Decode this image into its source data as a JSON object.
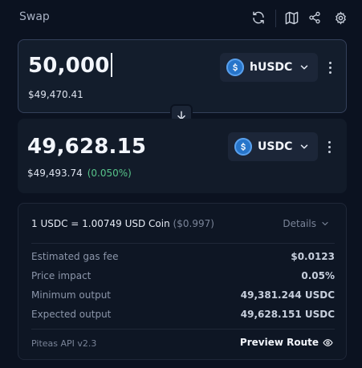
{
  "header": {
    "title": "Swap",
    "icons": [
      "refresh-icon",
      "map-icon",
      "share-icon",
      "settings-gear-icon"
    ]
  },
  "from": {
    "amount": "50,000",
    "usd_value": "$49,470.41",
    "token": "hUSDC",
    "token_icon": "usdc-coin-icon"
  },
  "to": {
    "amount": "49,628.15",
    "usd_value": "$49,493.74",
    "price_impact": "(0.050%)",
    "token": "USDC",
    "token_icon": "usdc-coin-icon"
  },
  "details": {
    "rate_main": "1 USDC = 1.00749 USD Coin",
    "rate_usd": "($0.997)",
    "toggle_label": "Details",
    "rows": [
      {
        "label": "Estimated gas fee",
        "value": "$0.0123"
      },
      {
        "label": "Price impact",
        "value": "0.05%"
      },
      {
        "label": "Minimum output",
        "value": "49,381.244 USDC"
      },
      {
        "label": "Expected output",
        "value": "49,628.151 USDC"
      }
    ],
    "api_version": "Piteas API v2.3",
    "preview_label": "Preview Route"
  },
  "colors": {
    "background": "#0b1220",
    "card": "#131d2c",
    "token_blue": "#2775ca",
    "positive_green": "#57c48a"
  }
}
